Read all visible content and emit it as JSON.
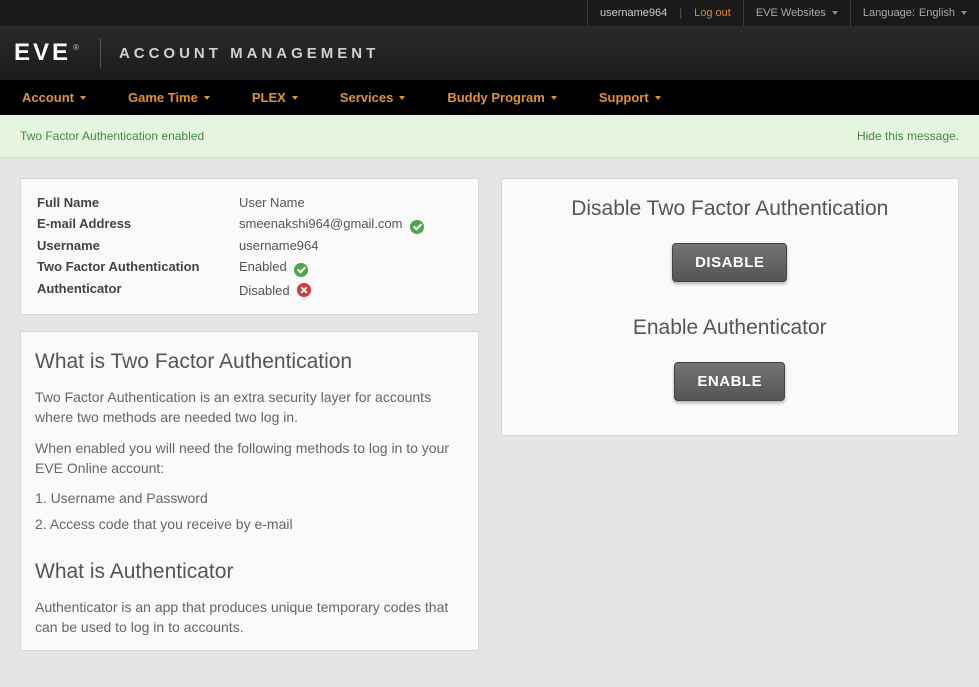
{
  "topbar": {
    "username": "username964",
    "logout": "Log out",
    "websites": "EVE Websites",
    "language_label": "Language:",
    "language_value": "English"
  },
  "header": {
    "logo": "EVE",
    "subtitle": "ACCOUNT MANAGEMENT"
  },
  "nav": {
    "items": [
      "Account",
      "Game Time",
      "PLEX",
      "Services",
      "Buddy Program",
      "Support"
    ]
  },
  "notify": {
    "message": "Two Factor Authentication enabled",
    "hide": "Hide this message."
  },
  "info": {
    "fullname_label": "Full Name",
    "fullname_value": "User Name",
    "email_label": "E-mail Address",
    "email_value": "smeenakshi964@gmail.com",
    "username_label": "Username",
    "username_value": "username964",
    "tfa_label": "Two Factor Authentication",
    "tfa_value": "Enabled",
    "auth_label": "Authenticator",
    "auth_value": "Disabled"
  },
  "explain": {
    "tfa_heading": "What is Two Factor Authentication",
    "tfa_p1": "Two Factor Authentication is an extra security layer for accounts where two methods are needed two log in.",
    "tfa_p2": "When enabled you will need the following methods to log in to your EVE Online account:",
    "tfa_m1": "1. Username and Password",
    "tfa_m2": "2. Access code that you receive by e-mail",
    "auth_heading": "What is Authenticator",
    "auth_p1": "Authenticator is an app that produces unique temporary codes that can be used to log in to accounts."
  },
  "actions": {
    "disable_tfa_heading": "Disable Two Factor Authentication",
    "disable_btn": "DISABLE",
    "enable_auth_heading": "Enable Authenticator",
    "enable_btn": "ENABLE"
  }
}
